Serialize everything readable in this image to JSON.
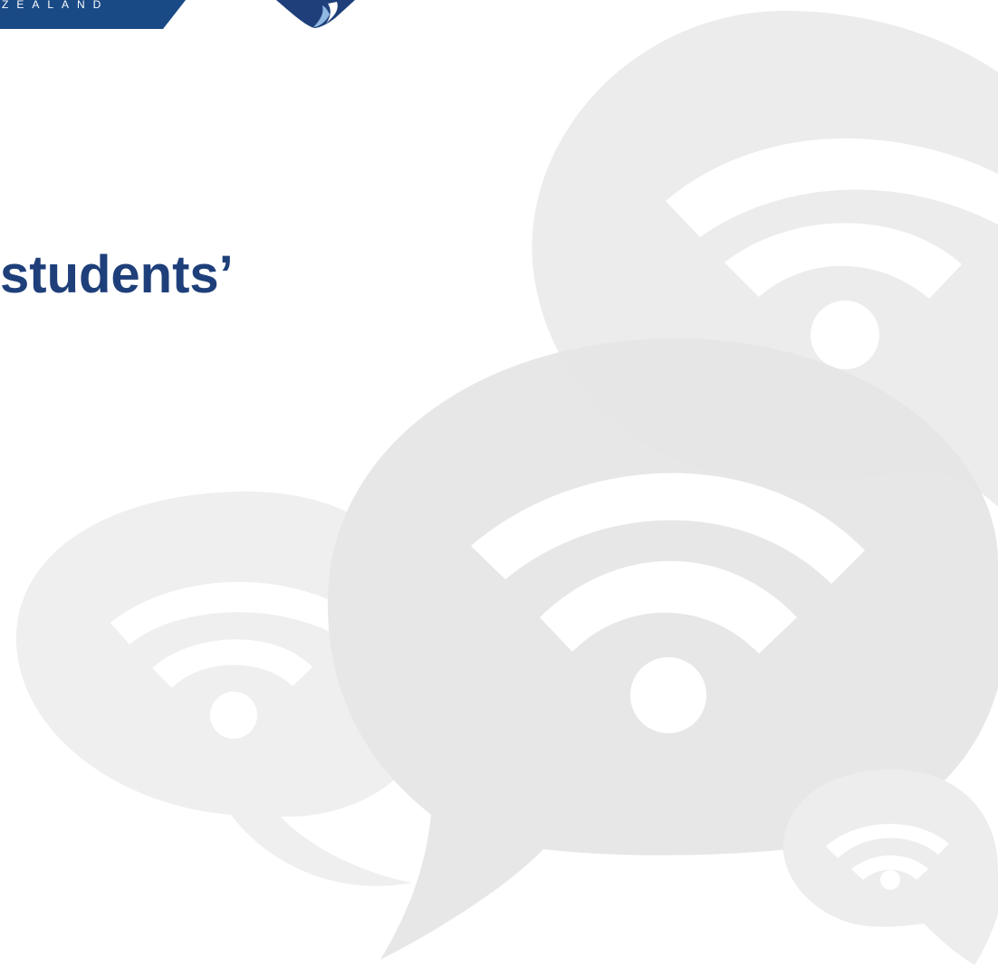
{
  "branding": {
    "banner_text": "ZEALAND",
    "banner_color": "#1a4a86",
    "crest_color": "#1e3f7a",
    "crest_accent_color": "#8fb8e3"
  },
  "slide": {
    "title": "students’",
    "title_color": "#1e3f7a",
    "background_icons": [
      "speech-bubble-wifi-icon",
      "speech-bubble-wifi-icon",
      "speech-bubble-wifi-icon",
      "speech-bubble-wifi-icon"
    ]
  }
}
